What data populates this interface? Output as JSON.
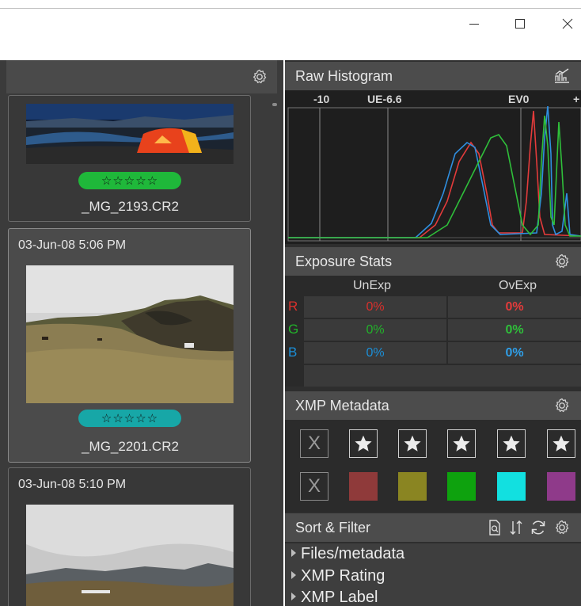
{
  "window": {
    "minimize_label": "—",
    "maximize_label": "☐",
    "close_label": "✕"
  },
  "thumbnails": [
    {
      "date": "",
      "filename": "_MG_2193.CR2",
      "rating": "☆☆☆☆☆",
      "rating_color": "#1fb83a"
    },
    {
      "date": "03-Jun-08 5:06 PM",
      "filename": "_MG_2201.CR2",
      "rating": "☆☆☆☆☆",
      "rating_color": "#17a7a7"
    },
    {
      "date": "03-Jun-08 5:10 PM",
      "filename": "",
      "rating": "",
      "rating_color": ""
    }
  ],
  "panels": {
    "histogram": {
      "title": "Raw Histogram",
      "labels": [
        "-10",
        "UE-6.6",
        "EV0",
        "+"
      ]
    },
    "exposure": {
      "title": "Exposure Stats",
      "col_unexp": "UnExp",
      "col_ovexp": "OvExp",
      "rows": [
        {
          "channel": "R",
          "unexp": "0%",
          "ovexp": "0%",
          "color": "#d9302c"
        },
        {
          "channel": "G",
          "unexp": "0%",
          "ovexp": "0%",
          "color": "#22b22a"
        },
        {
          "channel": "B",
          "unexp": "0%",
          "ovexp": "0%",
          "color": "#1b8fd8"
        }
      ]
    },
    "xmp": {
      "title": "XMP Metadata",
      "clear_label": "X",
      "label_colors": [
        "#8f3a3a",
        "#8a8522",
        "#0ea20e",
        "#12e0e0",
        "#8f3a8a"
      ]
    },
    "sort": {
      "title": "Sort & Filter",
      "items": [
        "Files/metadata",
        "XMP Rating",
        "XMP Label"
      ]
    }
  },
  "colors": {
    "accent_green": "#1fb83a",
    "accent_teal": "#17a7a7"
  }
}
